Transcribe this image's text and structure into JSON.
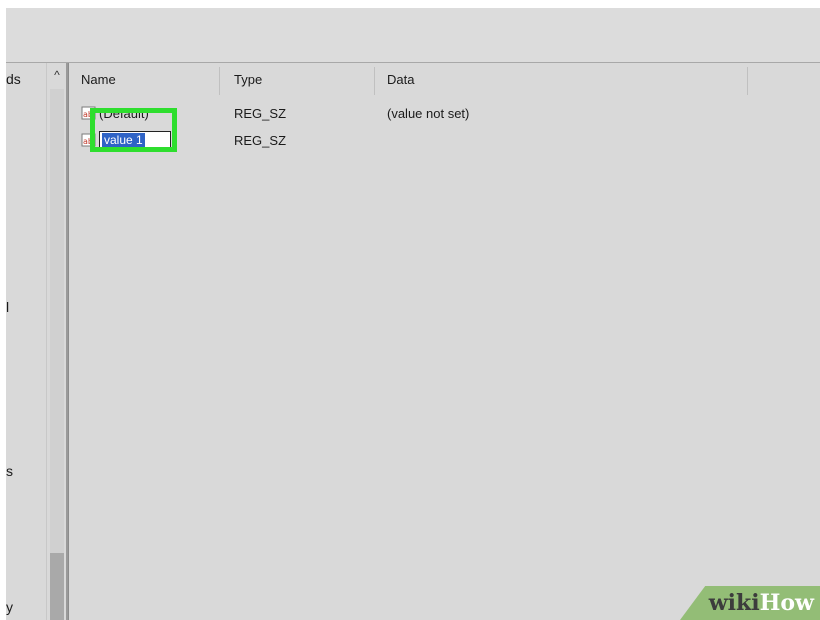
{
  "tree": {
    "fragments": [
      "ds",
      "l",
      "s",
      "y"
    ]
  },
  "scrollbar": {
    "up_arrow": "^"
  },
  "columns": {
    "name": "Name",
    "type": "Type",
    "data": "Data"
  },
  "rows": [
    {
      "name": "(Default)",
      "type": "REG_SZ",
      "data": "(value not set)"
    },
    {
      "name": "value 1",
      "type": "REG_SZ",
      "data": ""
    }
  ],
  "rename_field": {
    "value": "value 1"
  },
  "watermark": {
    "part1": "wiki",
    "part2": "How"
  },
  "colors": {
    "highlight": "#2ede2e",
    "selection": "#2f63c6",
    "watermark_bg": "#93bd76"
  }
}
